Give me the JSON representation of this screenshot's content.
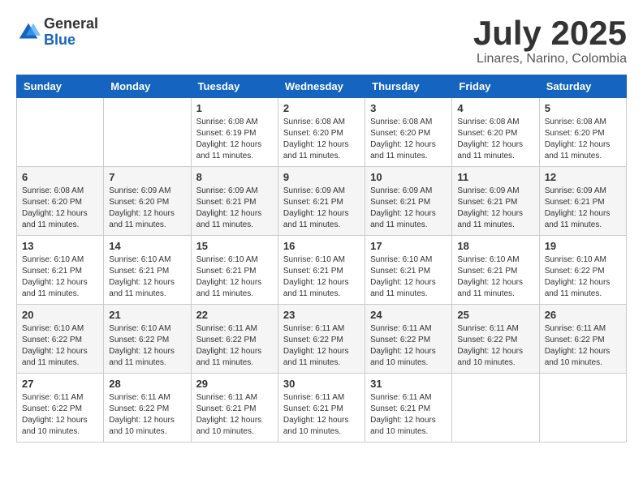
{
  "logo": {
    "general": "General",
    "blue": "Blue"
  },
  "title": {
    "month_year": "July 2025",
    "location": "Linares, Narino, Colombia"
  },
  "days_of_week": [
    "Sunday",
    "Monday",
    "Tuesday",
    "Wednesday",
    "Thursday",
    "Friday",
    "Saturday"
  ],
  "weeks": [
    [
      {
        "day": "",
        "info": ""
      },
      {
        "day": "",
        "info": ""
      },
      {
        "day": "1",
        "info": "Sunrise: 6:08 AM\nSunset: 6:19 PM\nDaylight: 12 hours and 11 minutes."
      },
      {
        "day": "2",
        "info": "Sunrise: 6:08 AM\nSunset: 6:20 PM\nDaylight: 12 hours and 11 minutes."
      },
      {
        "day": "3",
        "info": "Sunrise: 6:08 AM\nSunset: 6:20 PM\nDaylight: 12 hours and 11 minutes."
      },
      {
        "day": "4",
        "info": "Sunrise: 6:08 AM\nSunset: 6:20 PM\nDaylight: 12 hours and 11 minutes."
      },
      {
        "day": "5",
        "info": "Sunrise: 6:08 AM\nSunset: 6:20 PM\nDaylight: 12 hours and 11 minutes."
      }
    ],
    [
      {
        "day": "6",
        "info": "Sunrise: 6:08 AM\nSunset: 6:20 PM\nDaylight: 12 hours and 11 minutes."
      },
      {
        "day": "7",
        "info": "Sunrise: 6:09 AM\nSunset: 6:20 PM\nDaylight: 12 hours and 11 minutes."
      },
      {
        "day": "8",
        "info": "Sunrise: 6:09 AM\nSunset: 6:21 PM\nDaylight: 12 hours and 11 minutes."
      },
      {
        "day": "9",
        "info": "Sunrise: 6:09 AM\nSunset: 6:21 PM\nDaylight: 12 hours and 11 minutes."
      },
      {
        "day": "10",
        "info": "Sunrise: 6:09 AM\nSunset: 6:21 PM\nDaylight: 12 hours and 11 minutes."
      },
      {
        "day": "11",
        "info": "Sunrise: 6:09 AM\nSunset: 6:21 PM\nDaylight: 12 hours and 11 minutes."
      },
      {
        "day": "12",
        "info": "Sunrise: 6:09 AM\nSunset: 6:21 PM\nDaylight: 12 hours and 11 minutes."
      }
    ],
    [
      {
        "day": "13",
        "info": "Sunrise: 6:10 AM\nSunset: 6:21 PM\nDaylight: 12 hours and 11 minutes."
      },
      {
        "day": "14",
        "info": "Sunrise: 6:10 AM\nSunset: 6:21 PM\nDaylight: 12 hours and 11 minutes."
      },
      {
        "day": "15",
        "info": "Sunrise: 6:10 AM\nSunset: 6:21 PM\nDaylight: 12 hours and 11 minutes."
      },
      {
        "day": "16",
        "info": "Sunrise: 6:10 AM\nSunset: 6:21 PM\nDaylight: 12 hours and 11 minutes."
      },
      {
        "day": "17",
        "info": "Sunrise: 6:10 AM\nSunset: 6:21 PM\nDaylight: 12 hours and 11 minutes."
      },
      {
        "day": "18",
        "info": "Sunrise: 6:10 AM\nSunset: 6:21 PM\nDaylight: 12 hours and 11 minutes."
      },
      {
        "day": "19",
        "info": "Sunrise: 6:10 AM\nSunset: 6:22 PM\nDaylight: 12 hours and 11 minutes."
      }
    ],
    [
      {
        "day": "20",
        "info": "Sunrise: 6:10 AM\nSunset: 6:22 PM\nDaylight: 12 hours and 11 minutes."
      },
      {
        "day": "21",
        "info": "Sunrise: 6:10 AM\nSunset: 6:22 PM\nDaylight: 12 hours and 11 minutes."
      },
      {
        "day": "22",
        "info": "Sunrise: 6:11 AM\nSunset: 6:22 PM\nDaylight: 12 hours and 11 minutes."
      },
      {
        "day": "23",
        "info": "Sunrise: 6:11 AM\nSunset: 6:22 PM\nDaylight: 12 hours and 11 minutes."
      },
      {
        "day": "24",
        "info": "Sunrise: 6:11 AM\nSunset: 6:22 PM\nDaylight: 12 hours and 10 minutes."
      },
      {
        "day": "25",
        "info": "Sunrise: 6:11 AM\nSunset: 6:22 PM\nDaylight: 12 hours and 10 minutes."
      },
      {
        "day": "26",
        "info": "Sunrise: 6:11 AM\nSunset: 6:22 PM\nDaylight: 12 hours and 10 minutes."
      }
    ],
    [
      {
        "day": "27",
        "info": "Sunrise: 6:11 AM\nSunset: 6:22 PM\nDaylight: 12 hours and 10 minutes."
      },
      {
        "day": "28",
        "info": "Sunrise: 6:11 AM\nSunset: 6:22 PM\nDaylight: 12 hours and 10 minutes."
      },
      {
        "day": "29",
        "info": "Sunrise: 6:11 AM\nSunset: 6:21 PM\nDaylight: 12 hours and 10 minutes."
      },
      {
        "day": "30",
        "info": "Sunrise: 6:11 AM\nSunset: 6:21 PM\nDaylight: 12 hours and 10 minutes."
      },
      {
        "day": "31",
        "info": "Sunrise: 6:11 AM\nSunset: 6:21 PM\nDaylight: 12 hours and 10 minutes."
      },
      {
        "day": "",
        "info": ""
      },
      {
        "day": "",
        "info": ""
      }
    ]
  ]
}
